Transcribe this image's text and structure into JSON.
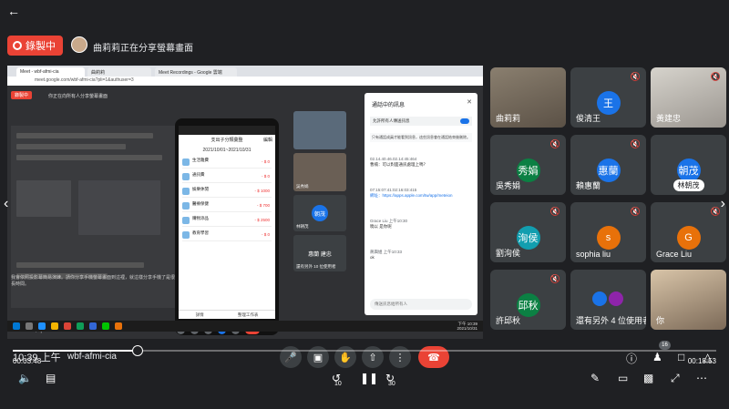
{
  "player": {
    "back_icon": "arrow-left-icon",
    "time_elapsed": "00:03:48",
    "time_total": "00:18:53",
    "progress_fraction": 0.178,
    "skip_back_label": "10",
    "skip_forward_label": "30"
  },
  "meet": {
    "recording_label": "錄製中",
    "presenting_text": "曲莉莉正在分享螢幕畫面",
    "time": "10:39 上午",
    "code": "wbf-afmi-cia",
    "participant_badge": "16",
    "accent": "#ea4335"
  },
  "shared_screen": {
    "tabs": [
      "Meet - wbf-afmi-cia",
      "曲莉莉",
      "Meet Recordings - Google 雲端"
    ],
    "url": "meet.google.com/wbf-afmi-cia?pli=1&authuser=3",
    "inner_recording": "錄製中",
    "inner_presenting": "你正在向所有人分享螢幕畫面",
    "caption": "我會依照投影幕簡易演練。請你分享手機螢幕畫面到這裡，就這樣分享手機了是很長時間。",
    "inner_time": "10:39 上午 | wbf-afmi-cia",
    "taskbar_time": "下午 10:39",
    "taskbar_date": "2021/10/31"
  },
  "phone": {
    "header": "支出子分類彙整",
    "header_action": "編輯",
    "date_range": "2021/10/01~2021/10/31",
    "rows": [
      {
        "name": "生活雜費",
        "sub": "(無備注)",
        "amount": "- $ 0"
      },
      {
        "name": "通訊費",
        "sub": "(無備注)",
        "amount": "- $ 0"
      },
      {
        "name": "娛樂休閒",
        "sub": "(無備注)",
        "amount": "- $ 1000"
      },
      {
        "name": "醫療保健",
        "sub": "(無備注)",
        "amount": "- $ 700"
      },
      {
        "name": "購物添品",
        "sub": "(無備注)",
        "amount": "- $ 2500"
      },
      {
        "name": "教育學習",
        "sub": "(無備注)",
        "amount": "- $ 0"
      }
    ],
    "tab_left": "詳情",
    "tab_right": "整理工作表"
  },
  "inner_tiles": [
    {
      "label": "你",
      "initial": ""
    },
    {
      "label": "吳秀娟",
      "initial": ""
    },
    {
      "label": "林朝茂",
      "initial": "朝茂"
    },
    {
      "label": "還有另外 10 位使用者",
      "initial": "惠蘭 建忠"
    }
  ],
  "chat": {
    "title": "通話中的訊息",
    "toggle_label": "允許所有人傳送訊息",
    "note": "只有通話成員才能看到訊息，這些訊息會在通話結束後刪除。",
    "messages": [
      {
        "head": "02.14.40.46.02.14:45:464",
        "body": "曹楠：可以對面通訊處理上嗎？"
      },
      {
        "head": "07:15:07:41:02:16:03:415",
        "body": "網址：https://apps.apple.com/tw/app/meteion",
        "link": true
      },
      {
        "head": "Grace Liu  上午10:30",
        "body": "曉以    是你呢"
      },
      {
        "head": "蔣興姐  上午10:33",
        "body": "ok"
      }
    ],
    "input_placeholder": "傳送訊息給所有人"
  },
  "participants": [
    {
      "name": "曲莉莉",
      "initial": "",
      "color": "#3c4043",
      "muted": false,
      "video": true
    },
    {
      "name": "俊清王",
      "initial": "王",
      "color": "#1a73e8",
      "muted": true,
      "video": false
    },
    {
      "name": "黃建忠",
      "initial": "",
      "color": "#3c4043",
      "muted": true,
      "video": true
    },
    {
      "name": "吳秀娟",
      "initial": "秀娟",
      "color": "#0b8043",
      "muted": true,
      "video": false
    },
    {
      "name": "賴惠蘭",
      "initial": "惠蘭",
      "color": "#1a73e8",
      "muted": true,
      "video": false
    },
    {
      "name": "林朝茂",
      "initial": "朝茂",
      "color": "#1a73e8",
      "muted": false,
      "video": false,
      "chip": true
    },
    {
      "name": "劉洵侯",
      "initial": "洵侯",
      "color": "#129eaf",
      "muted": true,
      "video": false
    },
    {
      "name": "sophia liu",
      "initial": "s",
      "color": "#e8710a",
      "muted": true,
      "video": false
    },
    {
      "name": "Grace Liu",
      "initial": "G",
      "color": "#e8710a",
      "muted": true,
      "video": false
    },
    {
      "name": "許邱秋",
      "initial": "邱秋",
      "color": "#0b8043",
      "muted": true,
      "video": false
    },
    {
      "name": "還有另外 4 位使用者",
      "initial": "",
      "color": "#3c4043",
      "muted": false,
      "video": false,
      "group": true
    },
    {
      "name": "你",
      "initial": "",
      "color": "#3c4043",
      "muted": false,
      "video": true
    }
  ]
}
